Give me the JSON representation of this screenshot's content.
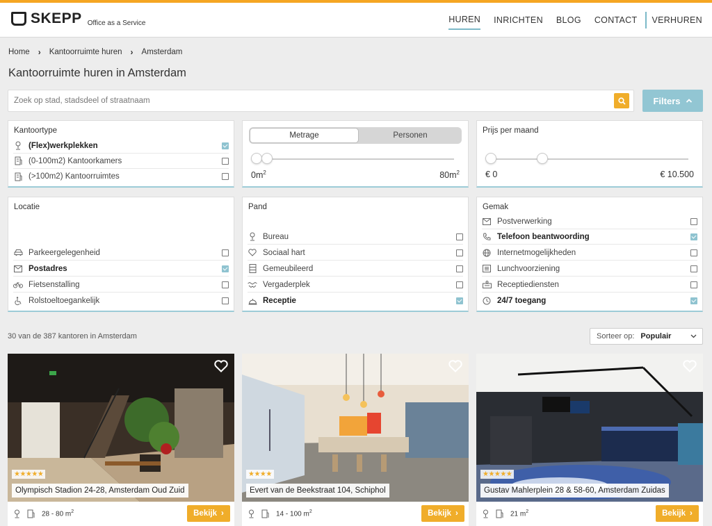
{
  "header": {
    "logo_text": "SKEPP",
    "tagline": "Office as a Service",
    "nav": [
      "HUREN",
      "INRICHTEN",
      "BLOG",
      "CONTACT",
      "VERHUREN"
    ],
    "active_nav": "HUREN",
    "accent_color": "#f5a623",
    "nav_accent": "#7cb9c8"
  },
  "breadcrumb": [
    "Home",
    "Kantoorruimte huren",
    "Amsterdam"
  ],
  "page_title": "Kantoorruimte huren in Amsterdam",
  "search": {
    "placeholder": "Zoek op stad, stadsdeel of straatnaam",
    "filters_label": "Filters"
  },
  "filters": {
    "kantoortype": {
      "title": "Kantoortype",
      "items": [
        {
          "label": "(Flex)werkplekken",
          "checked": true,
          "icon": "desk-lamp-icon"
        },
        {
          "label": "(0-100m2) Kantoorkamers",
          "checked": false,
          "icon": "building-icon"
        },
        {
          "label": "(>100m2) Kantoorruimtes",
          "checked": false,
          "icon": "building-icon"
        }
      ]
    },
    "metrage": {
      "toggle_active": "Metrage",
      "toggle_inactive": "Personen",
      "min_label": "0m",
      "max_label": "80m",
      "unit_sup": "2"
    },
    "prijs": {
      "title": "Prijs per maand",
      "min_label": "€ 0",
      "max_label": "€ 10.500"
    },
    "locatie": {
      "title": "Locatie",
      "items": [
        {
          "label": "Parkeergelegenheid",
          "checked": false,
          "icon": "car-icon"
        },
        {
          "label": "Postadres",
          "checked": true,
          "icon": "mail-icon"
        },
        {
          "label": "Fietsenstalling",
          "checked": false,
          "icon": "bicycle-icon"
        },
        {
          "label": "Rolstoeltoegankelijk",
          "checked": false,
          "icon": "wheelchair-icon"
        }
      ]
    },
    "pand": {
      "title": "Pand",
      "items": [
        {
          "label": "Bureau",
          "checked": false,
          "icon": "desk-lamp-icon"
        },
        {
          "label": "Sociaal hart",
          "checked": false,
          "icon": "heart-icon"
        },
        {
          "label": "Gemeubileerd",
          "checked": false,
          "icon": "cabinet-icon"
        },
        {
          "label": "Vergaderplek",
          "checked": false,
          "icon": "handshake-icon"
        },
        {
          "label": "Receptie",
          "checked": true,
          "icon": "bell-icon"
        }
      ]
    },
    "gemak": {
      "title": "Gemak",
      "items": [
        {
          "label": "Postverwerking",
          "checked": false,
          "icon": "mail-icon"
        },
        {
          "label": "Telefoon beantwoording",
          "checked": true,
          "icon": "phone-icon"
        },
        {
          "label": "Internetmogelijkheden",
          "checked": false,
          "icon": "globe-icon"
        },
        {
          "label": "Lunchvoorziening",
          "checked": false,
          "icon": "lunch-icon"
        },
        {
          "label": "Receptiediensten",
          "checked": false,
          "icon": "reception-icon"
        },
        {
          "label": "24/7 toegang",
          "checked": true,
          "icon": "clock-icon"
        }
      ]
    }
  },
  "results": {
    "count_text": "30 van de 387 kantoren in Amsterdam",
    "sort_label": "Sorteer op:",
    "sort_value": "Populair"
  },
  "cards": [
    {
      "address": "Olympisch Stadion 24-28, Amsterdam Oud Zuid",
      "stars": "★★★★★",
      "size": "28 - 80 m",
      "button": "Bekijk"
    },
    {
      "address": "Evert van de Beekstraat 104, Schiphol",
      "stars": "★★★★",
      "size": "14 - 100 m",
      "button": "Bekijk"
    },
    {
      "address": "Gustav Mahlerplein 28 & 58-60, Amsterdam Zuidas",
      "stars": "★★★★★",
      "size": "21 m",
      "button": "Bekijk"
    }
  ]
}
